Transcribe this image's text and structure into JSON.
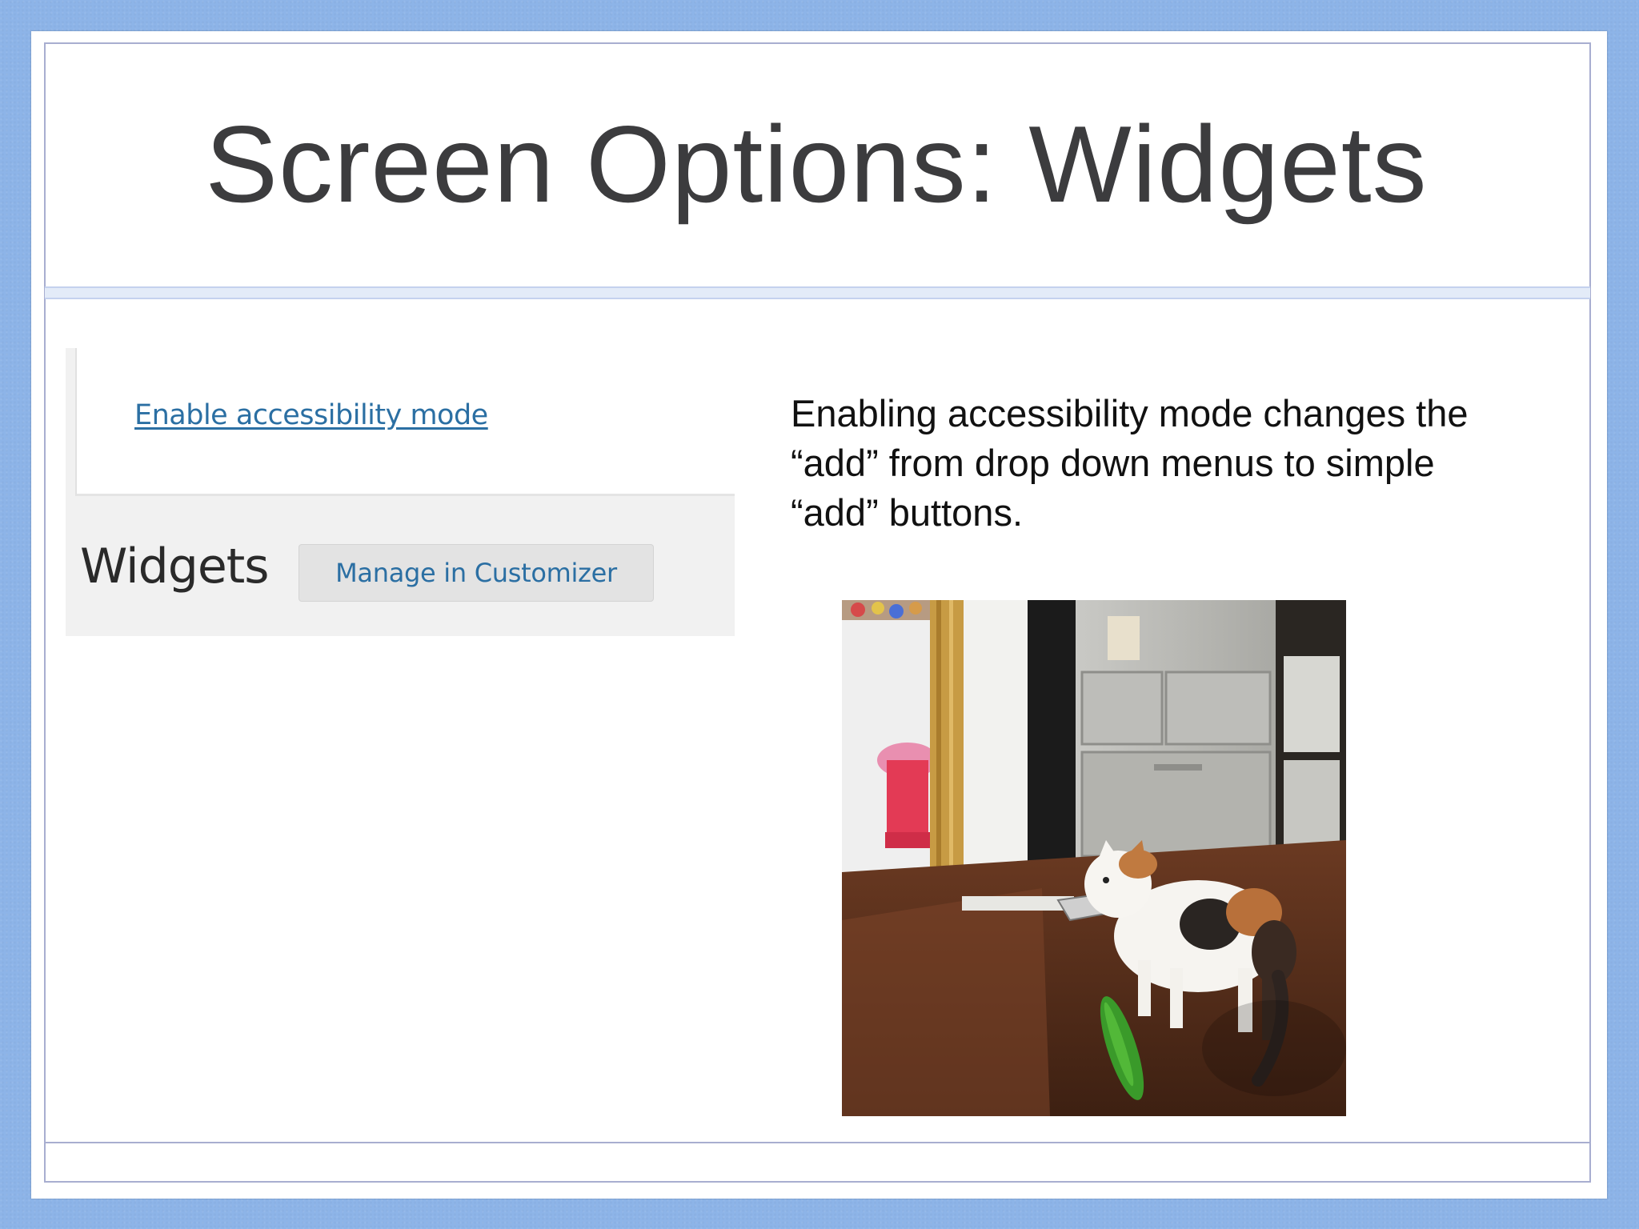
{
  "slide": {
    "title": "Screen Options: Widgets",
    "description_lines": [
      "Enabling accessibility mode changes the",
      "“add” from drop down menus to simple",
      "“add” buttons."
    ]
  },
  "wp_screenshot": {
    "accessibility_link": "Enable accessibility mode",
    "heading": "Widgets",
    "manage_button": "Manage in Customizer",
    "link_color": "#2b6fa3"
  },
  "photo": {
    "icon": "cat-cucumber-photo"
  }
}
